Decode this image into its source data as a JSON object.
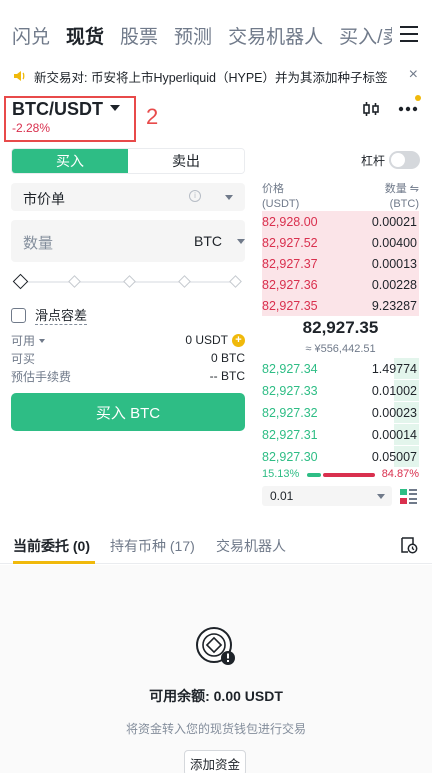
{
  "nav": {
    "tabs": [
      "闪兑",
      "现货",
      "股票",
      "预测",
      "交易机器人",
      "买入/卖出"
    ],
    "active_index": 1
  },
  "announcement": {
    "text": "新交易对: 币安将上市Hyperliquid（HYPE）并为其添加种子标签",
    "close": "×"
  },
  "pair": {
    "symbol": "BTC/USDT",
    "change": "-2.28%",
    "annotation": "2"
  },
  "order_form": {
    "buy_tab": "买入",
    "sell_tab": "卖出",
    "margin_label": "杠杆",
    "margin_enabled": false,
    "order_type": "市价单",
    "info_glyph": "i",
    "qty_placeholder": "数量",
    "qty_unit": "BTC",
    "slider_percent": 0,
    "slippage_label": "滑点容差",
    "available_label": "可用",
    "available_value": "0 USDT",
    "plus_glyph": "+",
    "can_buy_label": "可买",
    "can_buy_value": "0 BTC",
    "fee_label": "预估手续费",
    "fee_value": "-- BTC",
    "submit_label": "买入 BTC"
  },
  "order_book": {
    "price_header": "价格",
    "price_unit": "(USDT)",
    "qty_header": "数量 ⇋",
    "qty_unit": "(BTC)",
    "asks": [
      {
        "price": "82,928.00",
        "qty": "0.00021",
        "depth": 1.0
      },
      {
        "price": "82,927.52",
        "qty": "0.00400",
        "depth": 1.0
      },
      {
        "price": "82,927.37",
        "qty": "0.00013",
        "depth": 1.0
      },
      {
        "price": "82,927.36",
        "qty": "0.00228",
        "depth": 1.0
      },
      {
        "price": "82,927.35",
        "qty": "9.23287",
        "depth": 1.0
      }
    ],
    "last_price": "82,927.35",
    "fiat_price": "≈ ¥556,442.51",
    "bids": [
      {
        "price": "82,927.34",
        "qty": "1.49774",
        "depth": 0.16
      },
      {
        "price": "82,927.33",
        "qty": "0.01002",
        "depth": 0.16
      },
      {
        "price": "82,927.32",
        "qty": "0.00023",
        "depth": 0.16
      },
      {
        "price": "82,927.31",
        "qty": "0.00014",
        "depth": 0.16
      },
      {
        "price": "82,927.30",
        "qty": "0.05007",
        "depth": 0.16
      }
    ],
    "buy_ratio": "15.13%",
    "sell_ratio": "84.87%",
    "precision": "0.01"
  },
  "bottom_tabs": {
    "items": [
      "当前委托 (0)",
      "持有币种 (17)",
      "交易机器人"
    ],
    "active_index": 0
  },
  "empty_state": {
    "balance": "可用余额: 0.00 USDT",
    "hint": "将资金转入您的现货钱包进行交易",
    "add_funds": "添加资金"
  },
  "colors": {
    "buy": "#2ebd85",
    "sell": "#d9304e",
    "accent": "#f0b90b",
    "annotation": "#e84a4a"
  }
}
